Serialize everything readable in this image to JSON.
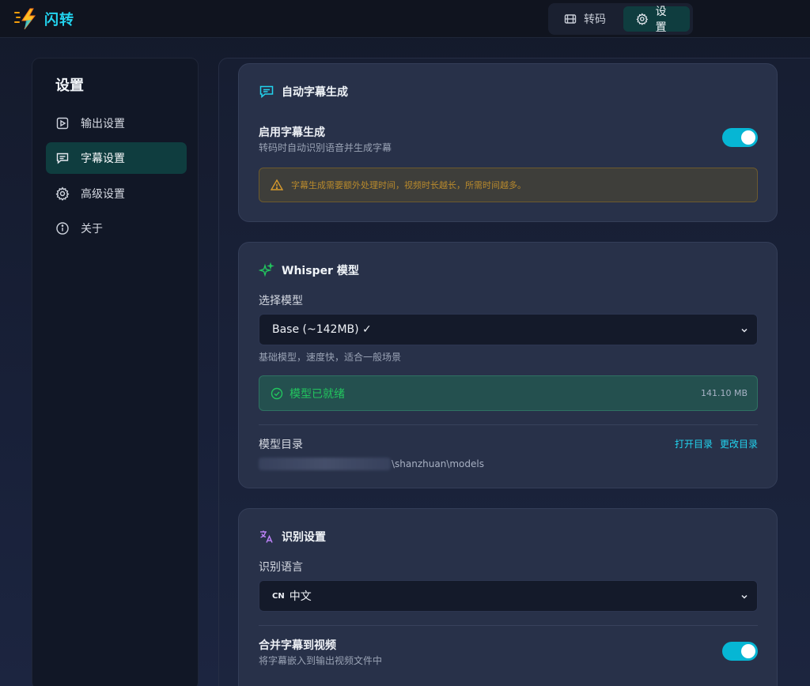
{
  "app": {
    "name": "闪转"
  },
  "nav": {
    "tabs": [
      {
        "label": "转码",
        "icon": "film-icon",
        "active": false
      },
      {
        "label": "设置",
        "icon": "gear-icon",
        "active": true
      }
    ]
  },
  "sidebar": {
    "title": "设置",
    "items": [
      {
        "label": "输出设置",
        "icon": "video-file-icon",
        "active": false
      },
      {
        "label": "字幕设置",
        "icon": "subtitle-icon",
        "active": true
      },
      {
        "label": "高级设置",
        "icon": "gear-icon",
        "active": false
      },
      {
        "label": "关于",
        "icon": "info-icon",
        "active": false
      }
    ]
  },
  "subtitle_card": {
    "title": "自动字幕生成",
    "enable_title": "启用字幕生成",
    "enable_desc": "转码时自动识别语音并生成字幕",
    "enabled": true,
    "warning": "字幕生成需要额外处理时间，视频时长越长，所需时间越多。"
  },
  "whisper_card": {
    "title": "Whisper 模型",
    "select_label": "选择模型",
    "model_value": "Base (~142MB) ✓",
    "model_desc": "基础模型，速度快，适合一般场景",
    "status_text": "模型已就绪",
    "status_size": "141.10 MB",
    "dir_label": "模型目录",
    "open_dir": "打开目录",
    "change_dir": "更改目录",
    "dir_path_suffix": "\\shanzhuan\\models"
  },
  "recog_card": {
    "title": "识别设置",
    "lang_label": "识别语言",
    "lang_flag": "CN",
    "lang_value": "中文",
    "merge_title": "合并字幕到视频",
    "merge_desc": "将字幕嵌入到输出视频文件中",
    "merge_enabled": true
  },
  "colors": {
    "accent": "#06b6d4",
    "active_bg": "#0f3d3f",
    "success": "#22c55e",
    "warning": "#b98a2c"
  }
}
